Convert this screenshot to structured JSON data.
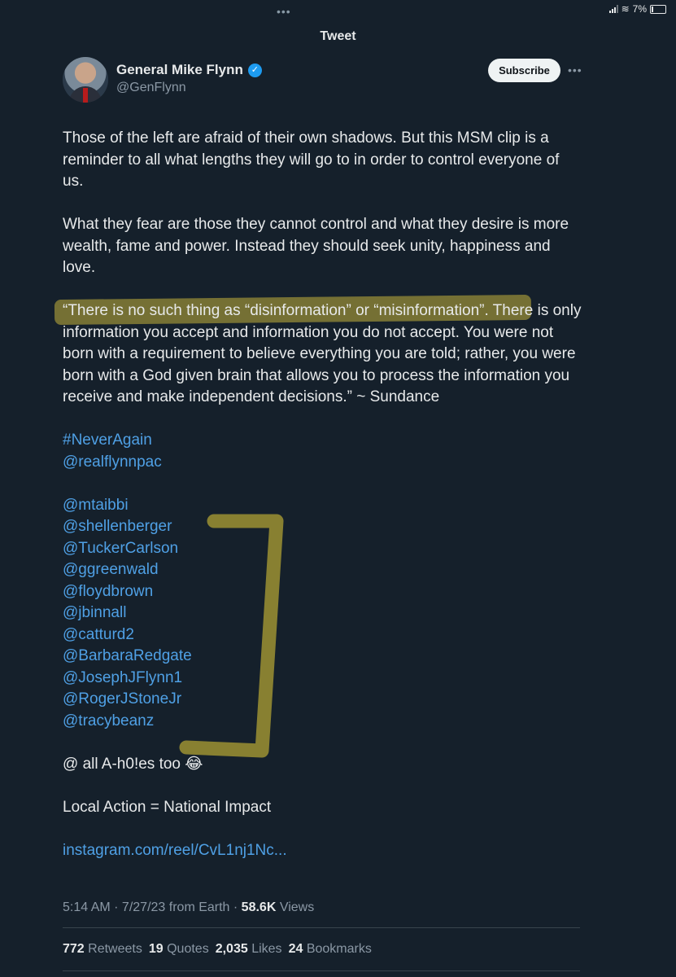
{
  "header": {
    "title": "Tweet",
    "status_battery": "7%"
  },
  "author": {
    "name": "General Mike Flynn",
    "handle": "@GenFlynn",
    "subscribe_label": "Subscribe"
  },
  "tweet": {
    "para1": "Those of the left are afraid of their own shadows. But this MSM clip is a reminder to all what lengths they will go to in order to control everyone of us.",
    "para2": "What they fear are those they cannot control and what they desire is more wealth, fame and power. Instead they should seek unity, happiness and love.",
    "para3": "“There is no such thing as “disinformation” or “misinformation”.  There is only information you accept and information you do not accept.  You were not born with a requirement to believe everything you are told; rather, you were born with a God given brain that allows you to process the information you receive and make independent decisions.” ~ Sundance",
    "tags": [
      "#NeverAgain",
      "@realflynnpac"
    ],
    "mentions": [
      "@mtaibbi",
      "@shellenberger",
      "@TuckerCarlson",
      "@ggreenwald",
      "@floydbrown",
      "@jbinnall",
      "@catturd2",
      "@BarbaraRedgate",
      "@JosephJFlynn1",
      "@RogerJStoneJr",
      "@tracybeanz"
    ],
    "line_all": "@ all A-h0!es too 😂",
    "line_local": "Local Action = National Impact",
    "link": "instagram.com/reel/CvL1nj1Nc..."
  },
  "meta": {
    "time": "5:14 AM",
    "date": "7/27/23",
    "source": "from Earth",
    "views_count": "58.6K",
    "views_label": "Views"
  },
  "stats": {
    "retweets_count": "772",
    "retweets_label": "Retweets",
    "quotes_count": "19",
    "quotes_label": "Quotes",
    "likes_count": "2,035",
    "likes_label": "Likes",
    "bookmarks_count": "24",
    "bookmarks_label": "Bookmarks"
  },
  "colors": {
    "background": "#15202b",
    "link": "#4fa0e5",
    "highlight": "#c4b23c",
    "verified": "#1d9bf0"
  }
}
